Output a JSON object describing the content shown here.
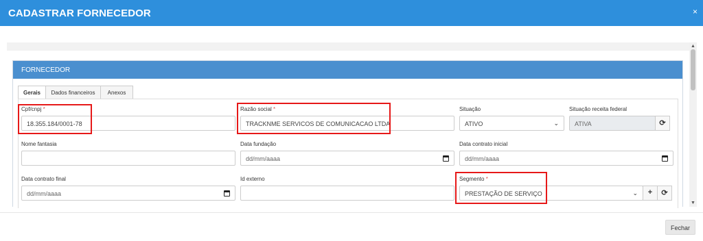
{
  "modal": {
    "title": "CADASTRAR FORNECEDOR",
    "close_glyph": "×"
  },
  "panel": {
    "heading": "FORNECEDOR"
  },
  "tabs": [
    {
      "label": "Gerais",
      "active": true
    },
    {
      "label": "Dados financeiros",
      "active": false
    },
    {
      "label": "Anexos",
      "active": false
    }
  ],
  "fields": {
    "cpf_cnpj": {
      "label": "Cpf/cnpj",
      "required": "*",
      "value": "18.355.184/0001-78"
    },
    "razao_social": {
      "label": "Razão social",
      "required": "*",
      "value": "TRACKNME SERVICOS DE COMUNICACAO LTDA"
    },
    "situacao": {
      "label": "Situação",
      "value": "ATIVO"
    },
    "situacao_receita": {
      "label": "Situação receita federal",
      "value": "ATIVA"
    },
    "nome_fantasia": {
      "label": "Nome fantasia",
      "value": ""
    },
    "data_fundacao": {
      "label": "Data fundação",
      "placeholder": "dd/mm/aaaa"
    },
    "data_contrato_inicial": {
      "label": "Data contrato inicial",
      "placeholder": "dd/mm/aaaa"
    },
    "data_contrato_final": {
      "label": "Data contrato final",
      "placeholder": "dd/mm/aaaa"
    },
    "id_externo": {
      "label": "Id externo",
      "value": ""
    },
    "segmento": {
      "label": "Segmento",
      "required": "*",
      "value": "PRESTAÇÃO DE SERVIÇO"
    }
  },
  "icons": {
    "refresh": "⟳",
    "plus": "+",
    "chevron": "⌄"
  },
  "footer": {
    "close_label": "Fechar"
  },
  "colors": {
    "header_blue": "#2e8fdc",
    "panel_blue": "#4a8fcf",
    "highlight_red": "#e61818",
    "required_red": "#d9534f"
  }
}
